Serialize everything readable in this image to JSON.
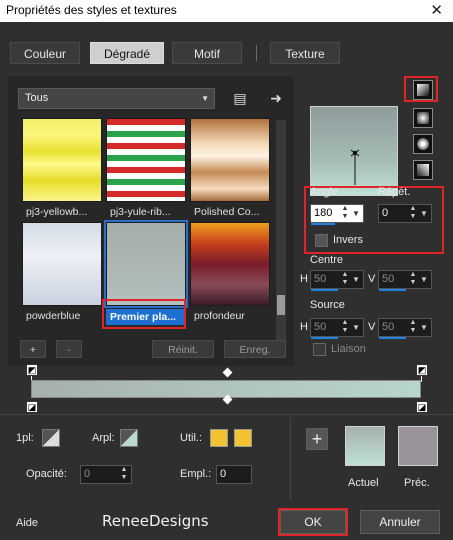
{
  "window": {
    "title": "Propriétés des styles et textures",
    "close_glyph": "✕"
  },
  "tabs": [
    {
      "label": "Couleur",
      "active": false
    },
    {
      "label": "Dégradé",
      "active": true
    },
    {
      "label": "Motif",
      "active": false
    },
    {
      "label": "Texture",
      "active": false
    }
  ],
  "library": {
    "category": "Tous",
    "thumbnails": [
      {
        "label": "pj3-yellowb..."
      },
      {
        "label": "pj3-yule-rib..."
      },
      {
        "label": "Polished Co..."
      },
      {
        "label": "powderblue"
      },
      {
        "label": "Premier pla...",
        "selected": true
      },
      {
        "label": "profondeur"
      }
    ],
    "add_label": "+",
    "remove_label": "-",
    "reset_label": "Réinit.",
    "save_label": "Enreg."
  },
  "settings": {
    "angle_label": "Angle",
    "angle_value": "180",
    "repeat_label": "Répét.",
    "repeat_value": "0",
    "invert_label": "Invers",
    "center_label": "Centre",
    "center_h_label": "H",
    "center_h_value": "50",
    "center_v_label": "V",
    "center_v_value": "50",
    "source_label": "Source",
    "source_h_label": "H",
    "source_h_value": "50",
    "source_v_label": "V",
    "source_v_value": "50",
    "link_label": "Liaison"
  },
  "stops": {
    "plan1_label": "1pl:",
    "arpl_label": "Arpl:",
    "util_label": "Util.:",
    "opacity_label": "Opacité:",
    "opacity_value": "0",
    "empl_label": "Empl.:",
    "empl_value": "0",
    "util_color": "#f2c230"
  },
  "swatches": {
    "add_label": "+",
    "current_label": "Actuel",
    "previous_label": "Préc.",
    "current_color": "#b9d9cd",
    "previous_color": "#9a9299"
  },
  "footer": {
    "help_label": "Aide",
    "watermark": "ReneeDesigns",
    "ok_label": "OK",
    "cancel_label": "Annuler"
  },
  "colors": {
    "highlight": "#e0252a",
    "selection": "#1e6fd0"
  }
}
